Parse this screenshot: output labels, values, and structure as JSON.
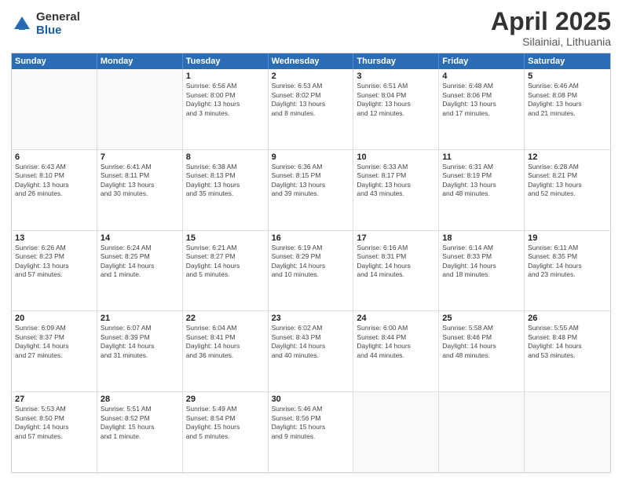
{
  "logo": {
    "general": "General",
    "blue": "Blue"
  },
  "title": {
    "month": "April 2025",
    "location": "Silainiai, Lithuania"
  },
  "calendar": {
    "headers": [
      "Sunday",
      "Monday",
      "Tuesday",
      "Wednesday",
      "Thursday",
      "Friday",
      "Saturday"
    ],
    "rows": [
      [
        {
          "day": "",
          "info": ""
        },
        {
          "day": "",
          "info": ""
        },
        {
          "day": "1",
          "info": "Sunrise: 6:56 AM\nSunset: 8:00 PM\nDaylight: 13 hours\nand 3 minutes."
        },
        {
          "day": "2",
          "info": "Sunrise: 6:53 AM\nSunset: 8:02 PM\nDaylight: 13 hours\nand 8 minutes."
        },
        {
          "day": "3",
          "info": "Sunrise: 6:51 AM\nSunset: 8:04 PM\nDaylight: 13 hours\nand 12 minutes."
        },
        {
          "day": "4",
          "info": "Sunrise: 6:48 AM\nSunset: 8:06 PM\nDaylight: 13 hours\nand 17 minutes."
        },
        {
          "day": "5",
          "info": "Sunrise: 6:46 AM\nSunset: 8:08 PM\nDaylight: 13 hours\nand 21 minutes."
        }
      ],
      [
        {
          "day": "6",
          "info": "Sunrise: 6:43 AM\nSunset: 8:10 PM\nDaylight: 13 hours\nand 26 minutes."
        },
        {
          "day": "7",
          "info": "Sunrise: 6:41 AM\nSunset: 8:11 PM\nDaylight: 13 hours\nand 30 minutes."
        },
        {
          "day": "8",
          "info": "Sunrise: 6:38 AM\nSunset: 8:13 PM\nDaylight: 13 hours\nand 35 minutes."
        },
        {
          "day": "9",
          "info": "Sunrise: 6:36 AM\nSunset: 8:15 PM\nDaylight: 13 hours\nand 39 minutes."
        },
        {
          "day": "10",
          "info": "Sunrise: 6:33 AM\nSunset: 8:17 PM\nDaylight: 13 hours\nand 43 minutes."
        },
        {
          "day": "11",
          "info": "Sunrise: 6:31 AM\nSunset: 8:19 PM\nDaylight: 13 hours\nand 48 minutes."
        },
        {
          "day": "12",
          "info": "Sunrise: 6:28 AM\nSunset: 8:21 PM\nDaylight: 13 hours\nand 52 minutes."
        }
      ],
      [
        {
          "day": "13",
          "info": "Sunrise: 6:26 AM\nSunset: 8:23 PM\nDaylight: 13 hours\nand 57 minutes."
        },
        {
          "day": "14",
          "info": "Sunrise: 6:24 AM\nSunset: 8:25 PM\nDaylight: 14 hours\nand 1 minute."
        },
        {
          "day": "15",
          "info": "Sunrise: 6:21 AM\nSunset: 8:27 PM\nDaylight: 14 hours\nand 5 minutes."
        },
        {
          "day": "16",
          "info": "Sunrise: 6:19 AM\nSunset: 8:29 PM\nDaylight: 14 hours\nand 10 minutes."
        },
        {
          "day": "17",
          "info": "Sunrise: 6:16 AM\nSunset: 8:31 PM\nDaylight: 14 hours\nand 14 minutes."
        },
        {
          "day": "18",
          "info": "Sunrise: 6:14 AM\nSunset: 8:33 PM\nDaylight: 14 hours\nand 18 minutes."
        },
        {
          "day": "19",
          "info": "Sunrise: 6:11 AM\nSunset: 8:35 PM\nDaylight: 14 hours\nand 23 minutes."
        }
      ],
      [
        {
          "day": "20",
          "info": "Sunrise: 6:09 AM\nSunset: 8:37 PM\nDaylight: 14 hours\nand 27 minutes."
        },
        {
          "day": "21",
          "info": "Sunrise: 6:07 AM\nSunset: 8:39 PM\nDaylight: 14 hours\nand 31 minutes."
        },
        {
          "day": "22",
          "info": "Sunrise: 6:04 AM\nSunset: 8:41 PM\nDaylight: 14 hours\nand 36 minutes."
        },
        {
          "day": "23",
          "info": "Sunrise: 6:02 AM\nSunset: 8:43 PM\nDaylight: 14 hours\nand 40 minutes."
        },
        {
          "day": "24",
          "info": "Sunrise: 6:00 AM\nSunset: 8:44 PM\nDaylight: 14 hours\nand 44 minutes."
        },
        {
          "day": "25",
          "info": "Sunrise: 5:58 AM\nSunset: 8:46 PM\nDaylight: 14 hours\nand 48 minutes."
        },
        {
          "day": "26",
          "info": "Sunrise: 5:55 AM\nSunset: 8:48 PM\nDaylight: 14 hours\nand 53 minutes."
        }
      ],
      [
        {
          "day": "27",
          "info": "Sunrise: 5:53 AM\nSunset: 8:50 PM\nDaylight: 14 hours\nand 57 minutes."
        },
        {
          "day": "28",
          "info": "Sunrise: 5:51 AM\nSunset: 8:52 PM\nDaylight: 15 hours\nand 1 minute."
        },
        {
          "day": "29",
          "info": "Sunrise: 5:49 AM\nSunset: 8:54 PM\nDaylight: 15 hours\nand 5 minutes."
        },
        {
          "day": "30",
          "info": "Sunrise: 5:46 AM\nSunset: 8:56 PM\nDaylight: 15 hours\nand 9 minutes."
        },
        {
          "day": "",
          "info": ""
        },
        {
          "day": "",
          "info": ""
        },
        {
          "day": "",
          "info": ""
        }
      ]
    ]
  }
}
